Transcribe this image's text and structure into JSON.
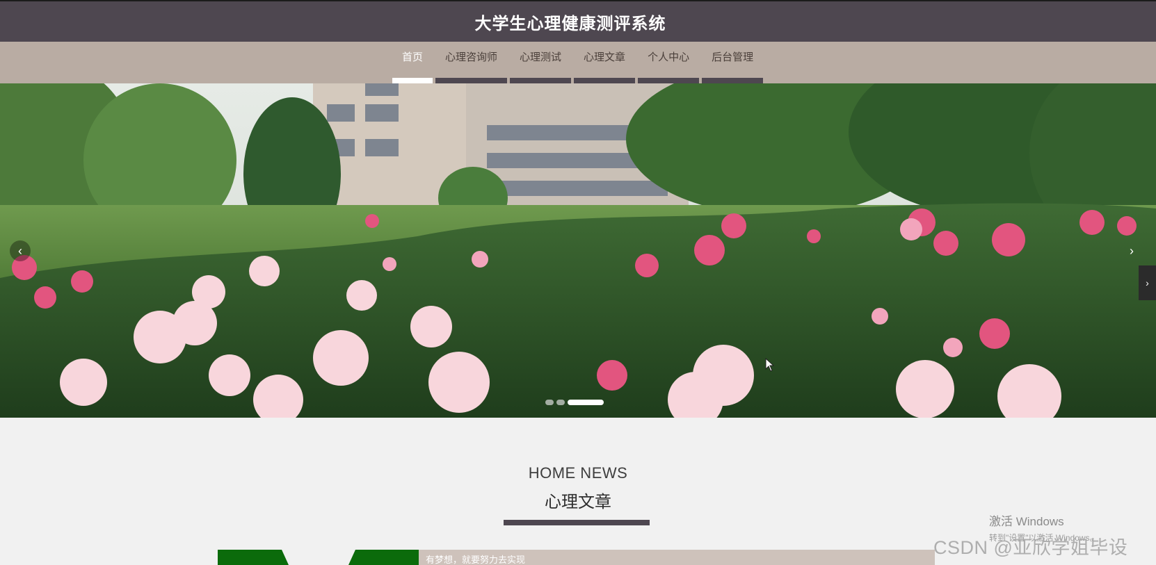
{
  "header": {
    "title": "大学生心理健康测评系统"
  },
  "nav": {
    "items": [
      {
        "label": "首页",
        "active": true
      },
      {
        "label": "心理咨询师",
        "active": false
      },
      {
        "label": "心理测试",
        "active": false
      },
      {
        "label": "心理文章",
        "active": false
      },
      {
        "label": "个人中心",
        "active": false
      },
      {
        "label": "后台管理",
        "active": false
      }
    ]
  },
  "carousel": {
    "prev_icon": "chevron-left-icon",
    "next_icon": "chevron-right-icon",
    "prev_glyph": "‹",
    "next_glyph": "›",
    "side_glyph": "›",
    "slide_count": 3,
    "active_slide": 3,
    "image_subject": "campus-peony-garden"
  },
  "news": {
    "title_en": "HOME NEWS",
    "title_cn": "心理文章",
    "first_card_text": "有梦想，就要努力去实现"
  },
  "watermarks": {
    "windows_title": "激活 Windows",
    "windows_sub": "转到\"设置\"以激活 Windows。",
    "csdn": "CSDN @亚欣学姐毕设"
  },
  "colors": {
    "header_bg": "#4e4750",
    "nav_bg": "#b9aca3",
    "accent_dark": "#4e4750",
    "page_bg": "#f1f1f1",
    "card_bar": "#cec2bb",
    "card_green": "#0b6b0b"
  }
}
